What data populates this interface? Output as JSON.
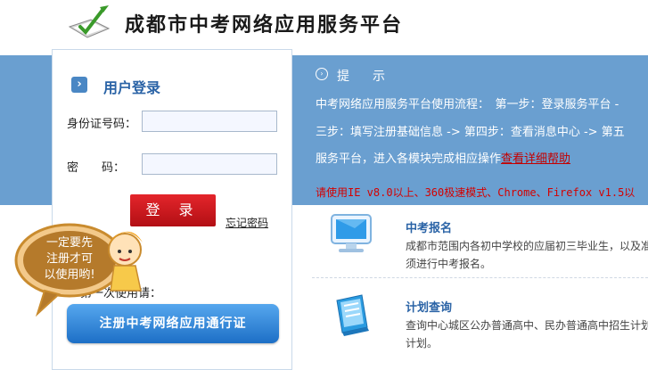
{
  "header": {
    "site_title": "成都市中考网络应用服务平台"
  },
  "login": {
    "title": "用户登录",
    "id_label": "身份证号码：",
    "password_label": "密　　码：",
    "id_value": "",
    "password_value": "",
    "login_button": "登 录",
    "forgot_link": "忘记密码",
    "first_use_text": "第一次使用请：",
    "register_button": "注册中考网络应用通行证"
  },
  "mascot": {
    "bubble_line1": "一定要先",
    "bubble_line2": "注册才可",
    "bubble_line3": "以使用哟!"
  },
  "notice": {
    "title": "提　示",
    "line1": "中考网络应用服务平台使用流程：　第一步：登录服务平台 -",
    "line2": "三步：填写注册基础信息 -> 第四步：查看消息中心 -> 第五",
    "line3_prefix": "服务平台，进入各模块完成相应操作",
    "line3_link": "查看详细帮助",
    "warning": "请使用IE v8.0以上、360极速模式、Chrome、Firefox v1.5以"
  },
  "modules": [
    {
      "title": "中考报名",
      "desc_line1": "成都市范围内各初中学校的应届初三毕业生，以及准",
      "desc_line2": "须进行中考报名。",
      "icon": "monitor-icon"
    },
    {
      "title": "计划查询",
      "desc_line1": "查询中心城区公办普通高中、民办普通高中招生计划",
      "desc_line2": "计划。",
      "icon": "notebook-icon"
    }
  ],
  "colors": {
    "band": "#6a9fd0",
    "login_button": "#d21a20",
    "register_button": "#2f86d8",
    "module_title": "#2a63a6",
    "warning": "#d40000"
  }
}
